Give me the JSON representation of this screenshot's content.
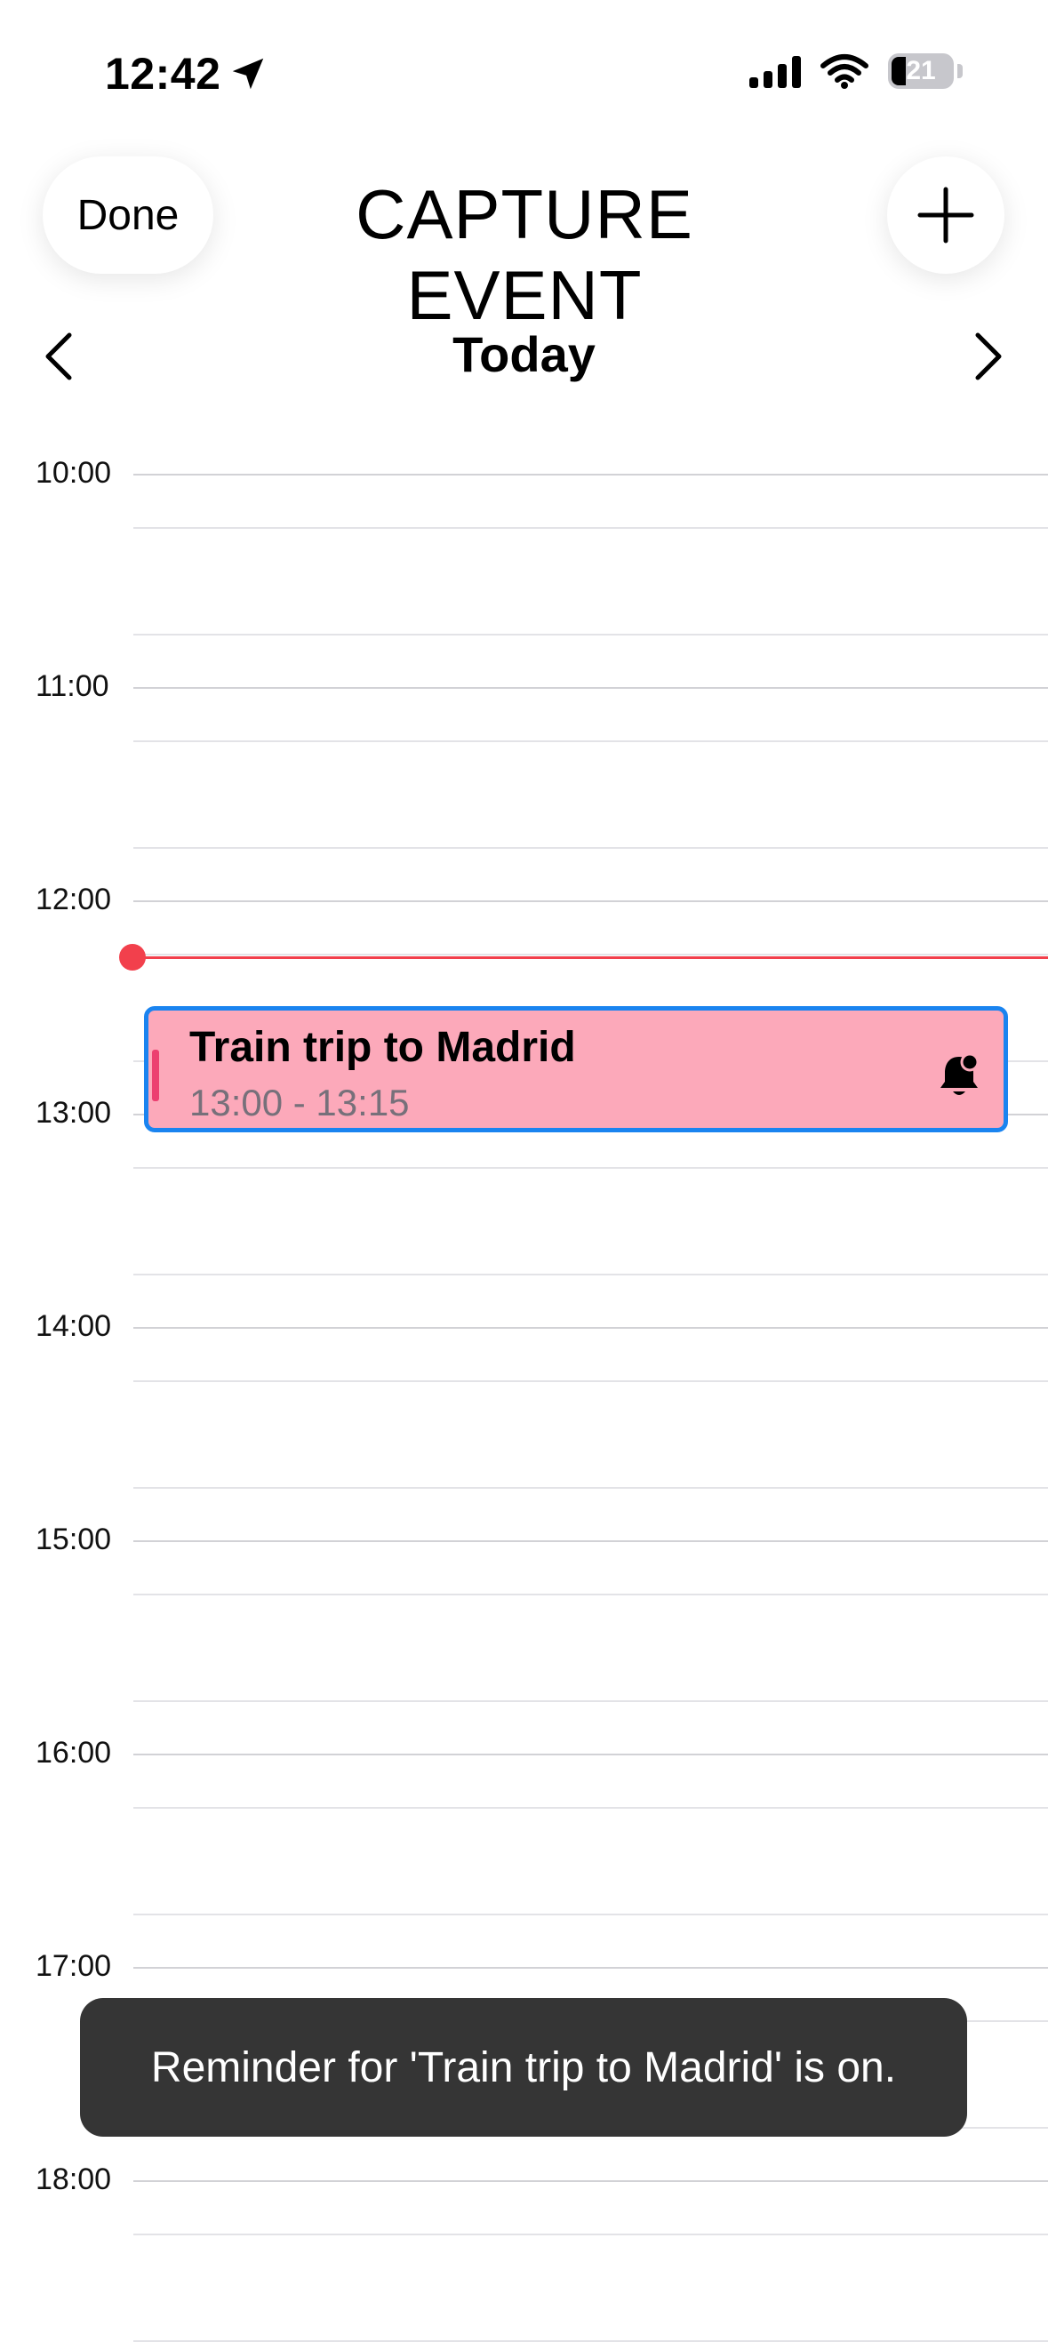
{
  "status_bar": {
    "time": "12:42",
    "battery": "21",
    "location_icon": "location-arrow-icon",
    "signal_icon": "cellular-signal-icon",
    "wifi_icon": "wifi-icon"
  },
  "header": {
    "done_label": "Done",
    "title": "CAPTURE EVENT",
    "add_icon": "plus-icon"
  },
  "nav": {
    "day_label": "Today",
    "prev_icon": "chevron-left-icon",
    "next_icon": "chevron-right-icon"
  },
  "timeline": {
    "hours": [
      "10:00",
      "11:00",
      "12:00",
      "13:00",
      "14:00",
      "15:00",
      "16:00",
      "17:00",
      "18:00"
    ]
  },
  "event": {
    "title": "Train trip to Madrid",
    "time": "13:00 - 13:15",
    "reminder_icon": "bell-icon",
    "colors": {
      "fill": "#fca9ba",
      "border": "#1a84f0",
      "stripe": "#ec3f70"
    }
  },
  "now_indicator": {
    "color": "#f2404c"
  },
  "toast": {
    "message": "Reminder for 'Train trip to Madrid' is on."
  }
}
